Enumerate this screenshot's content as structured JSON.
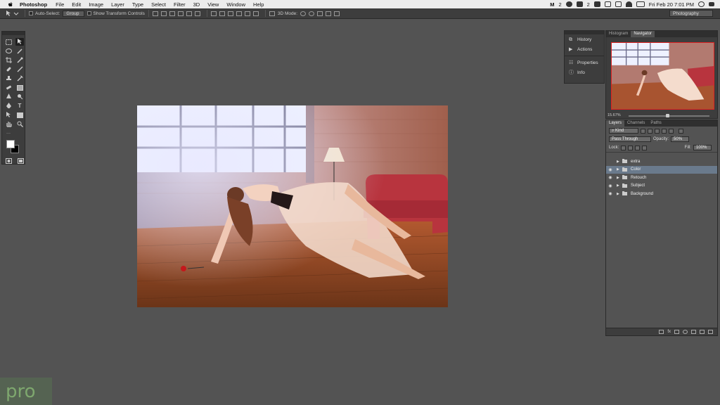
{
  "menubar": {
    "app_name": "Photoshop",
    "items": [
      "File",
      "Edit",
      "Image",
      "Layer",
      "Type",
      "Select",
      "Filter",
      "3D",
      "View",
      "Window",
      "Help"
    ],
    "status": {
      "badge": "2",
      "badge2": "2",
      "datetime": "Fri Feb 20  7:01 PM"
    }
  },
  "options_bar": {
    "auto_select_label": "Auto-Select:",
    "auto_select_value": "Group",
    "show_transform_label": "Show Transform Controls",
    "mode_3d_label": "3D Mode:",
    "workspace": "Photography"
  },
  "mini_panel": {
    "items": [
      {
        "icon": "history-icon",
        "label": "History"
      },
      {
        "icon": "actions-icon",
        "label": "Actions"
      },
      {
        "icon": "properties-icon",
        "label": "Properties"
      },
      {
        "icon": "info-icon",
        "label": "Info"
      }
    ]
  },
  "navigator_panel": {
    "tabs": [
      "Histogram",
      "Navigator"
    ],
    "active_tab": "Navigator",
    "zoom": "15.67%",
    "zoom_slider_fraction": 0.48
  },
  "layers_panel": {
    "tabs": [
      "Layers",
      "Channels",
      "Paths"
    ],
    "active_tab": "Layers",
    "filter_kind": "Kind",
    "blend_mode": "Pass Through",
    "opacity_label": "Opacity:",
    "opacity_value": "50%",
    "lock_label": "Lock:",
    "fill_label": "Fill:",
    "fill_value": "100%",
    "layers": [
      {
        "name": "extra",
        "visible": false,
        "selected": false
      },
      {
        "name": "Color",
        "visible": true,
        "selected": true
      },
      {
        "name": "Retouch",
        "visible": true,
        "selected": false
      },
      {
        "name": "Subject",
        "visible": true,
        "selected": false
      },
      {
        "name": "Background",
        "visible": true,
        "selected": false
      }
    ]
  },
  "watermark": "pro"
}
